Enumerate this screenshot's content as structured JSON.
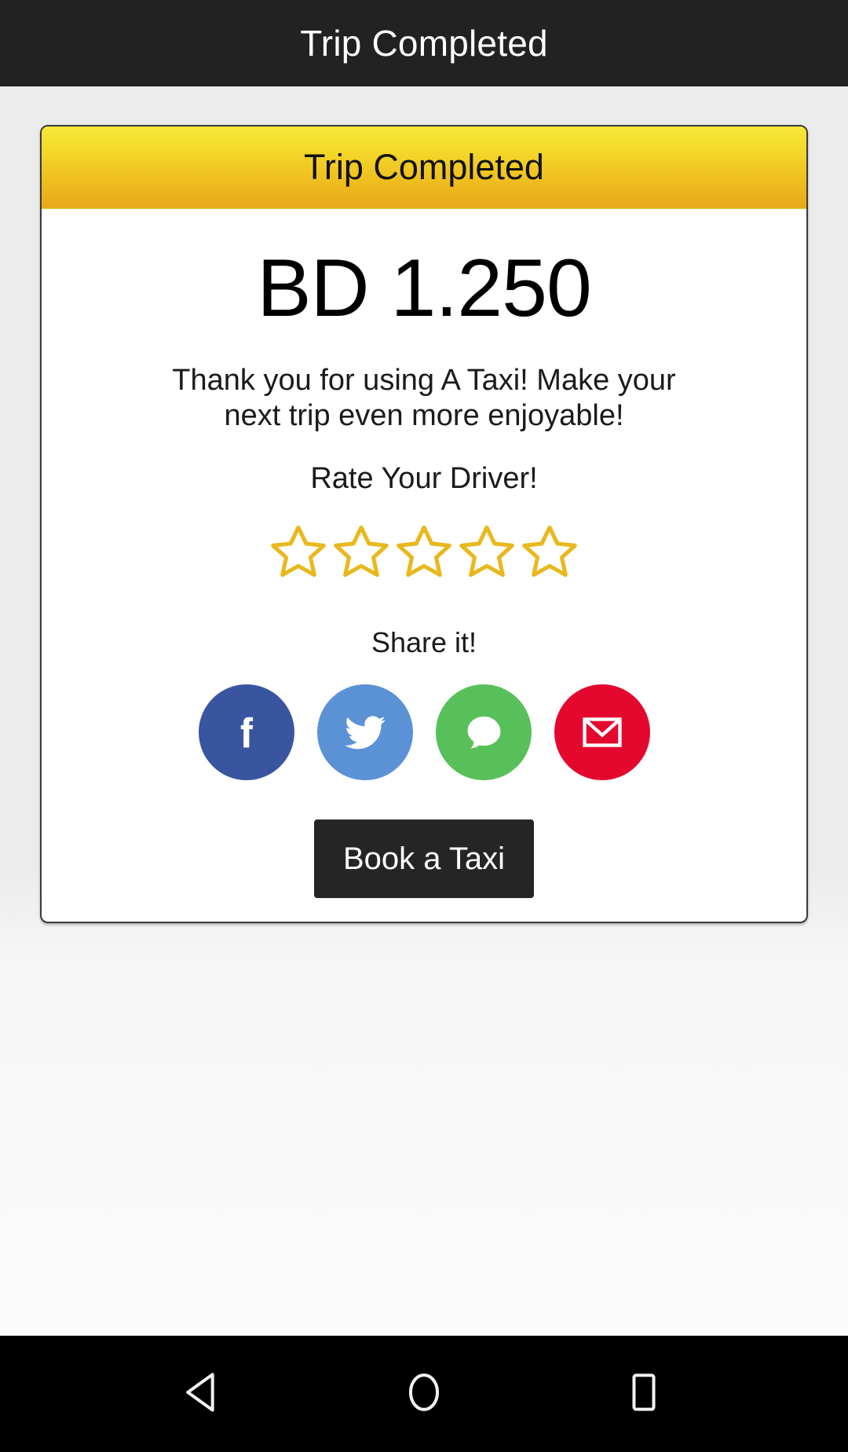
{
  "appbar": {
    "title": "Trip Completed"
  },
  "card": {
    "header_title": "Trip Completed",
    "fare": "BD 1.250",
    "thanks_message": "Thank you for using A Taxi! Make your next trip even more enjoyable!",
    "rate_label": "Rate Your Driver!",
    "share_label": "Share it!",
    "book_button": "Book a Taxi"
  },
  "rating": {
    "value": 0,
    "max": 5,
    "star_color": "#e9b81d",
    "stars": [
      {
        "name": "star-1",
        "filled": false
      },
      {
        "name": "star-2",
        "filled": false
      },
      {
        "name": "star-3",
        "filled": false
      },
      {
        "name": "star-4",
        "filled": false
      },
      {
        "name": "star-5",
        "filled": false
      }
    ]
  },
  "share_targets": [
    {
      "icon": "facebook-icon",
      "label": "Facebook",
      "color": "#3a559f"
    },
    {
      "icon": "twitter-icon",
      "label": "Twitter",
      "color": "#5b92d6"
    },
    {
      "icon": "sms-message-icon",
      "label": "Message",
      "color": "#58c05a"
    },
    {
      "icon": "email-icon",
      "label": "Email",
      "color": "#e4082f"
    }
  ],
  "navbar": [
    {
      "icon": "back-icon",
      "label": "Back"
    },
    {
      "icon": "home-icon",
      "label": "Home"
    },
    {
      "icon": "recents-icon",
      "label": "Recents"
    }
  ],
  "colors": {
    "appbar_bg": "#222222",
    "page_bg": "#ececec",
    "card_header_top": "#f7e93a",
    "card_header_bottom": "#e7a81a",
    "button_bg": "#252525",
    "navbar_bg": "#000000"
  }
}
